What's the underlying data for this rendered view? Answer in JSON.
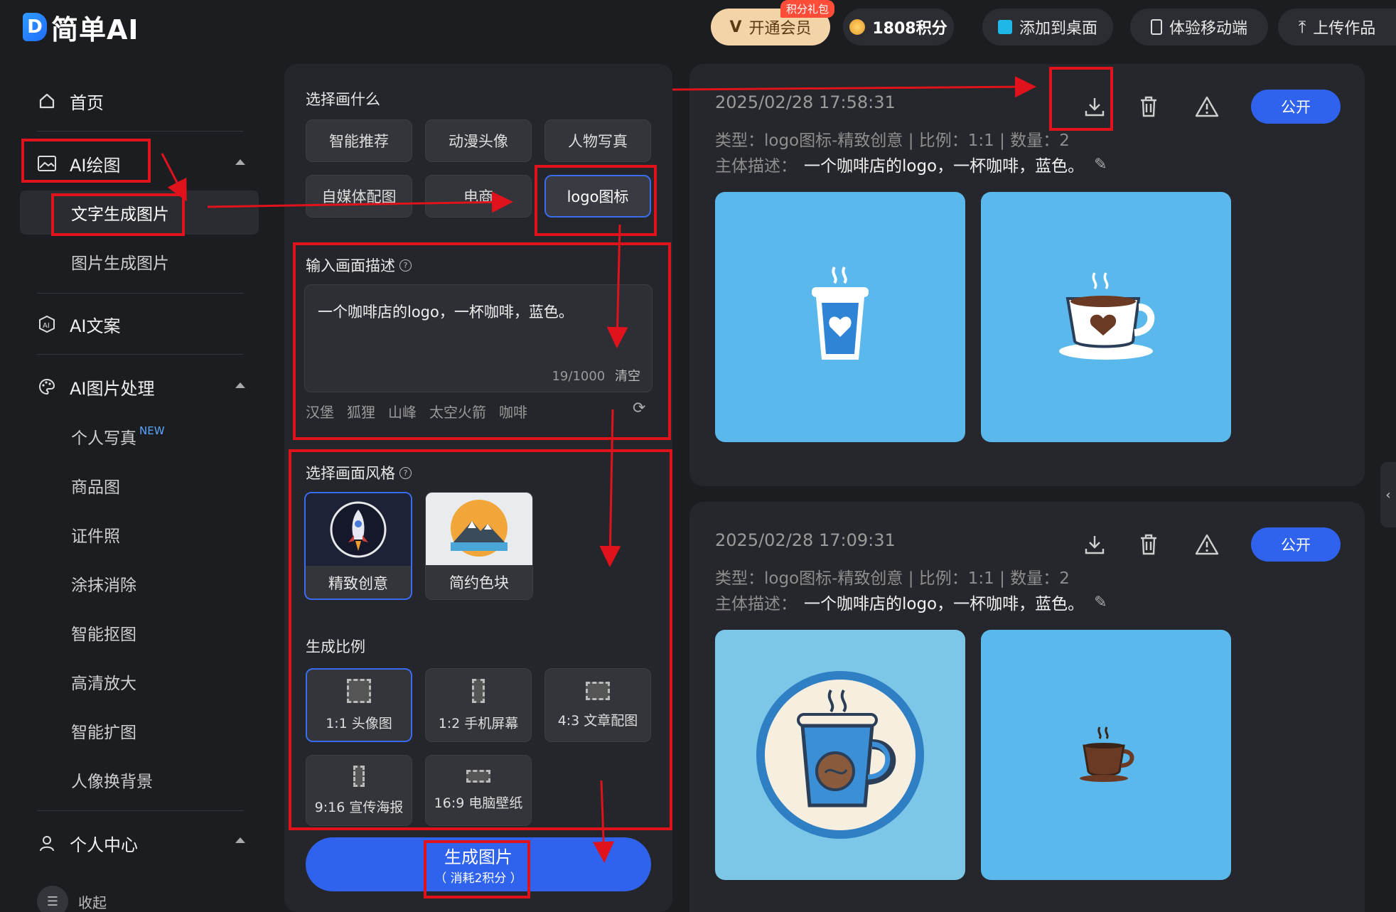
{
  "brand": {
    "mark": "D",
    "name": "简单AI"
  },
  "topbar": {
    "vip": {
      "label": "开通会员",
      "badge": "积分礼包"
    },
    "points": "1808积分",
    "add_desktop": "添加到桌面",
    "mobile": "体验移动端",
    "upload": "上传作品"
  },
  "sidebar": {
    "home": "首页",
    "ai_draw": "AI绘图",
    "text_to_image": "文字生成图片",
    "image_to_image": "图片生成图片",
    "ai_copy": "AI文案",
    "ai_image_process": "AI图片处理",
    "process_items": [
      "个人写真",
      "商品图",
      "证件照",
      "涂抹消除",
      "智能抠图",
      "高清放大",
      "智能扩图",
      "人像换背景"
    ],
    "new_badge": "NEW",
    "personal_center": "个人中心",
    "collapse": "收起"
  },
  "form": {
    "choose_what": "选择画什么",
    "categories": [
      "智能推荐",
      "动漫头像",
      "人物写真",
      "自媒体配图",
      "电商",
      "logo图标"
    ],
    "selected_category": "logo图标",
    "input_desc_title": "输入画面描述",
    "description": "一个咖啡店的logo，一杯咖啡，蓝色。",
    "char_count": "19/1000",
    "clear": "清空",
    "suggest_tags": [
      "汉堡",
      "狐狸",
      "山峰",
      "太空火箭",
      "咖啡"
    ],
    "style_title": "选择画面风格",
    "styles": [
      "精致创意",
      "简约色块"
    ],
    "ratio_title": "生成比例",
    "ratios": [
      "1:1 头像图",
      "1:2 手机屏幕",
      "4:3 文章配图",
      "9:16 宣传海报",
      "16:9 电脑壁纸"
    ],
    "generate": "生成图片",
    "generate_cost": "（ 消耗2积分 ）"
  },
  "results": [
    {
      "timestamp": "2025/02/28 17:58:31",
      "type_line": "类型：logo图标-精致创意 | 比例：1:1 | 数量：2",
      "subject_label": "主体描述：",
      "subject": "一个咖啡店的logo，一杯咖啡，蓝色。",
      "public": "公开"
    },
    {
      "timestamp": "2025/02/28 17:09:31",
      "type_line": "类型：logo图标-精致创意 | 比例：1:1 | 数量：2",
      "subject_label": "主体描述：",
      "subject": "一个咖啡店的logo，一杯咖啡，蓝色。",
      "public": "公开"
    }
  ],
  "colors": {
    "accent": "#2f63ee",
    "annotation": "#e0121b",
    "thumb_bg": "#5ab8ec"
  }
}
